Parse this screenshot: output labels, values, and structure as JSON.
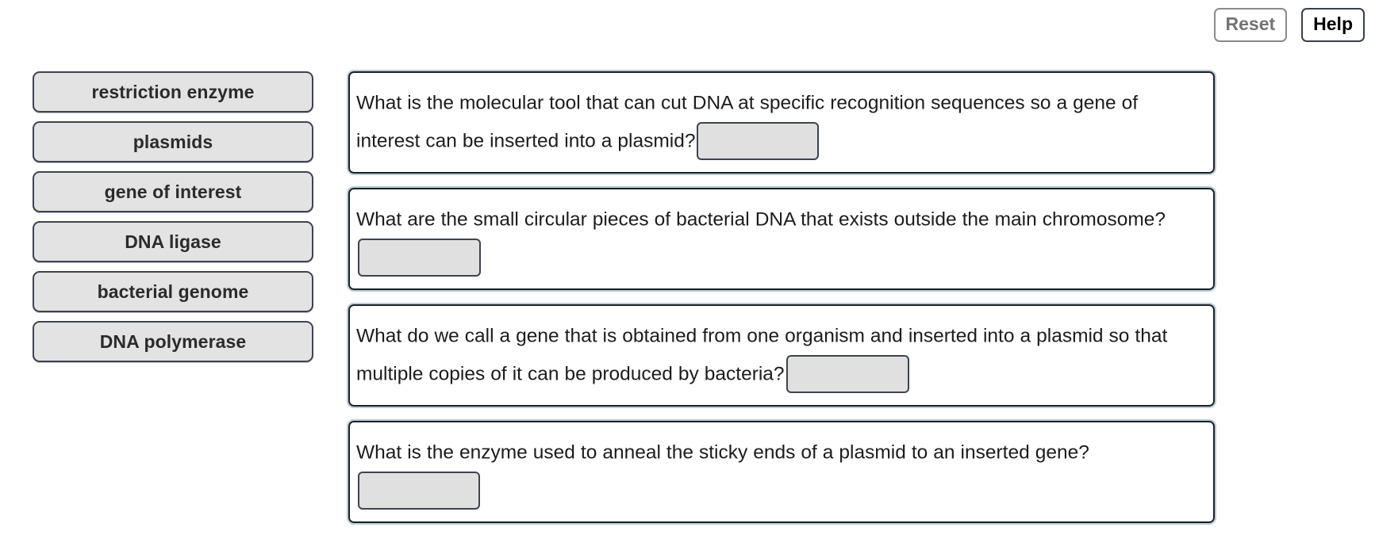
{
  "toolbar": {
    "reset_label": "Reset",
    "help_label": "Help"
  },
  "wordbank": {
    "items": [
      {
        "label": "restriction enzyme"
      },
      {
        "label": "plasmids"
      },
      {
        "label": "gene of interest"
      },
      {
        "label": "DNA ligase"
      },
      {
        "label": "bacterial genome"
      },
      {
        "label": "DNA polymerase"
      }
    ]
  },
  "questions": [
    {
      "before": "What is the molecular tool that can cut DNA at specific recognition sequences so a gene of interest can be inserted into a plasmid?",
      "after": "",
      "answer": ""
    },
    {
      "before": "What are the small circular pieces of bacterial DNA that exists outside the main chromosome?",
      "after": "",
      "answer": ""
    },
    {
      "before": "What do we call a gene that is obtained from one organism and inserted into a plasmid so that multiple copies of it can be produced by bacteria?",
      "after": "",
      "answer": ""
    },
    {
      "before": "What is the enzyme used to anneal the sticky ends of a plasmid to an inserted gene?",
      "after": "",
      "answer": ""
    }
  ],
  "colors": {
    "chip_fill": "#e3e3e3",
    "chip_border": "#3f4350",
    "box_border": "#1b2026",
    "box_outline": "#b9ccd4",
    "dropzone_fill": "#e0e0e0",
    "reset_text": "#737373",
    "help_text": "#000000"
  }
}
